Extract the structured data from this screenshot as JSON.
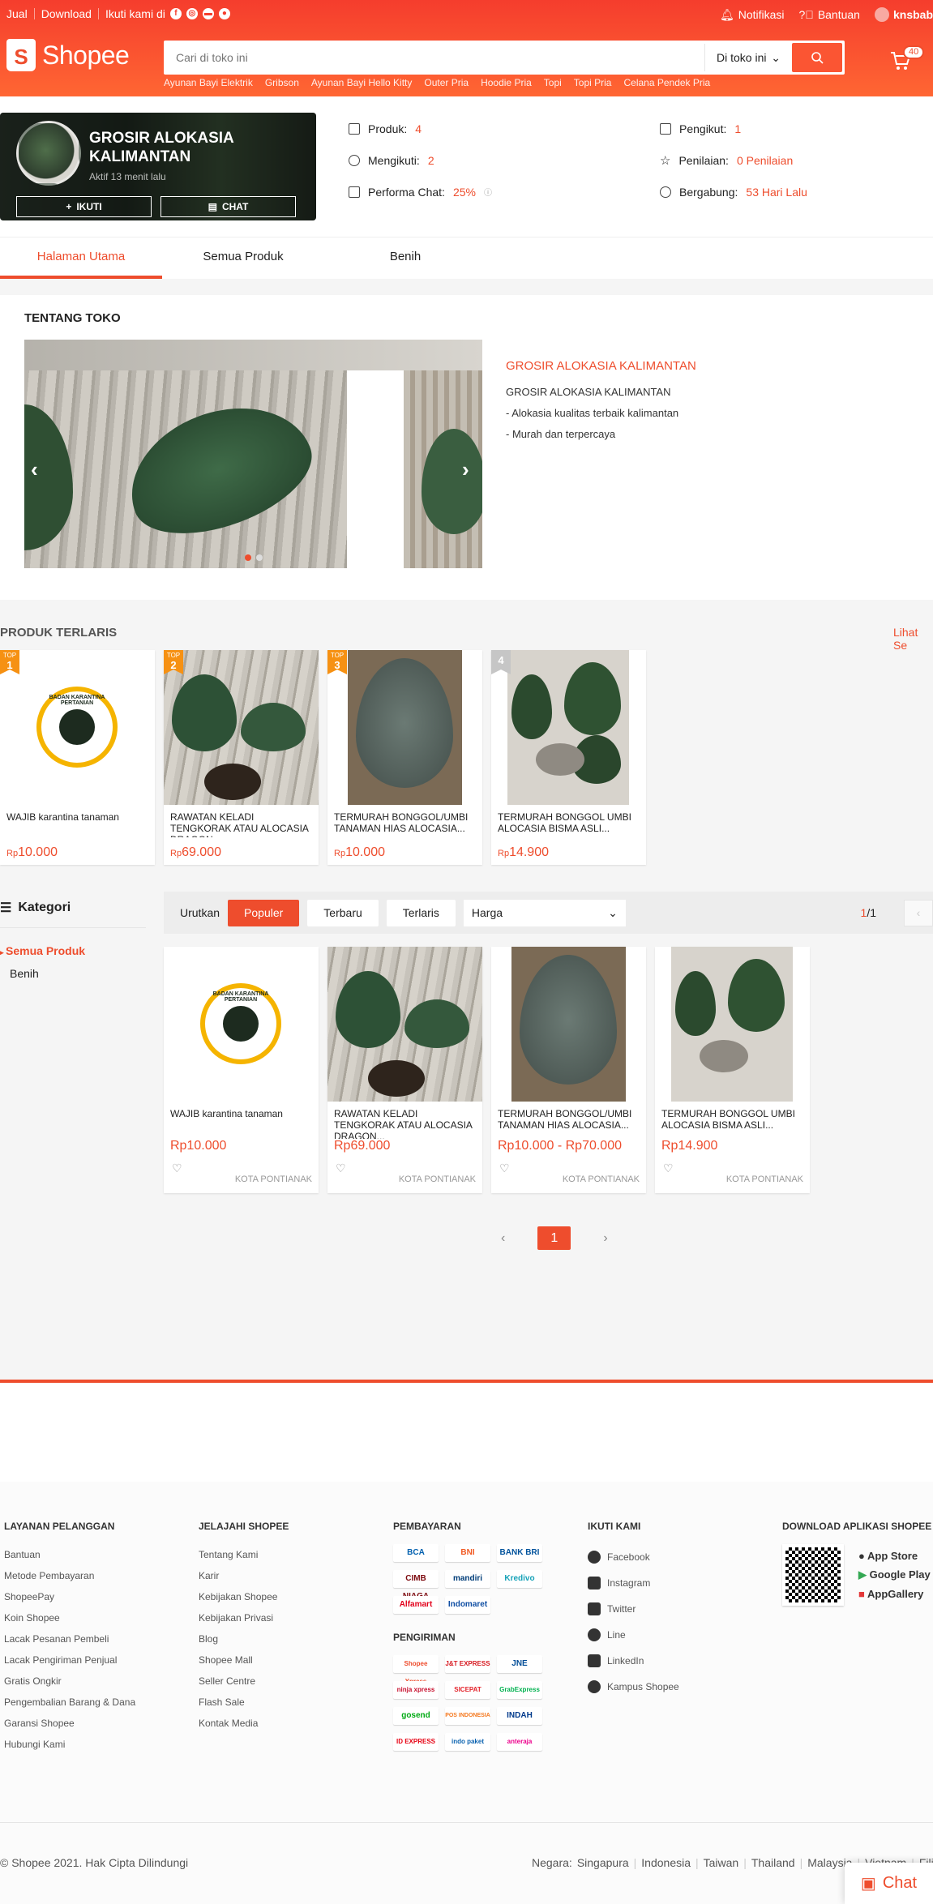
{
  "topbar": {
    "jual": "Jual",
    "download": "Download",
    "follow": "Ikuti kami di",
    "notifikasi": "Notifikasi",
    "bantuan": "Bantuan",
    "user": "knsbab"
  },
  "header": {
    "logo": "Shopee",
    "search_placeholder": "Cari di toko ini",
    "scope": "Di toko ini",
    "cart_count": "40",
    "hints": [
      "Ayunan Bayi Elektrik",
      "Gribson",
      "Ayunan Bayi Hello Kitty",
      "Outer Pria",
      "Hoodie Pria",
      "Topi",
      "Topi Pria",
      "Celana Pendek Pria"
    ]
  },
  "shop": {
    "name": "GROSIR ALOKASIA KALIMANTAN",
    "active": "Aktif 13 menit lalu",
    "follow_btn": "IKUTI",
    "chat_btn": "CHAT",
    "stats": [
      {
        "label": "Produk:",
        "value": "4"
      },
      {
        "label": "Mengikuti:",
        "value": "2"
      },
      {
        "label": "Performa Chat:",
        "value": "25%"
      },
      {
        "label": "Pengikut:",
        "value": "1"
      },
      {
        "label": "Penilaian:",
        "value": "0 Penilaian"
      },
      {
        "label": "Bergabung:",
        "value": "53 Hari Lalu"
      }
    ],
    "tabs": [
      "Halaman Utama",
      "Semua Produk",
      "Benih"
    ]
  },
  "about": {
    "heading": "TENTANG TOKO",
    "title": "GROSIR ALOKASIA KALIMANTAN",
    "lines": [
      "GROSIR ALOKASIA KALIMANTAN",
      "- Alokasia kualitas terbaik kalimantan",
      "- Murah dan terpercaya"
    ]
  },
  "top": {
    "heading": "PRODUK TERLARIS",
    "more": "Lihat Se",
    "items": [
      {
        "rank": "1",
        "name": "WAJIB karantina tanaman",
        "currency": "Rp",
        "price": "10.000"
      },
      {
        "rank": "2",
        "name": "RAWATAN KELADI TENGKORAK ATAU ALOCASIA DRAGON...",
        "currency": "Rp",
        "price": "69.000"
      },
      {
        "rank": "3",
        "name": "TERMURAH BONGGOL/UMBI TANAMAN HIAS ALOCASIA...",
        "currency": "Rp",
        "price": "10.000"
      },
      {
        "rank": "4",
        "name": "TERMURAH BONGGOL UMBI ALOCASIA BISMA ASLI...",
        "currency": "Rp",
        "price": "14.900"
      }
    ]
  },
  "kategori": {
    "heading": "Kategori",
    "items": [
      "Semua Produk",
      "Benih"
    ]
  },
  "sort": {
    "label": "Urutkan",
    "options": [
      "Populer",
      "Terbaru",
      "Terlaris"
    ],
    "price": "Harga",
    "page_cur": "1",
    "page_total": "/1"
  },
  "grid": [
    {
      "name": "WAJIB karantina tanaman",
      "price": "Rp10.000",
      "loc": "KOTA PONTIANAK"
    },
    {
      "name": "RAWATAN KELADI TENGKORAK ATAU ALOCASIA DRAGON...",
      "price": "Rp69.000",
      "loc": "KOTA PONTIANAK"
    },
    {
      "name": "TERMURAH BONGGOL/UMBI TANAMAN HIAS ALOCASIA...",
      "price": "Rp10.000 - Rp70.000",
      "loc": "KOTA PONTIANAK"
    },
    {
      "name": "TERMURAH BONGGOL UMBI ALOCASIA BISMA ASLI...",
      "price": "Rp14.900",
      "loc": "KOTA PONTIANAK"
    }
  ],
  "pager": {
    "current": "1"
  },
  "seal_text": "BADAN KARANTINA PERTANIAN",
  "footer": {
    "layanan": {
      "h": "LAYANAN PELANGGAN",
      "items": [
        "Bantuan",
        "Metode Pembayaran",
        "ShopeePay",
        "Koin Shopee",
        "Lacak Pesanan Pembeli",
        "Lacak Pengiriman Penjual",
        "Gratis Ongkir",
        "Pengembalian Barang & Dana",
        "Garansi Shopee",
        "Hubungi Kami"
      ]
    },
    "jelajahi": {
      "h": "JELAJAHI SHOPEE",
      "items": [
        "Tentang Kami",
        "Karir",
        "Kebijakan Shopee",
        "Kebijakan Privasi",
        "Blog",
        "Shopee Mall",
        "Seller Centre",
        "Flash Sale",
        "Kontak Media"
      ]
    },
    "pembayaran": {
      "h": "PEMBAYARAN",
      "items": [
        "BCA",
        "BNI",
        "BANK BRI",
        "CIMB NIAGA",
        "mandiri",
        "Kredivo",
        "Alfamart",
        "Indomaret"
      ]
    },
    "pengiriman": {
      "h": "PENGIRIMAN",
      "items": [
        "Shopee Xpress",
        "J&T EXPRESS",
        "JNE",
        "ninja xpress",
        "SICEPAT",
        "GrabExpress",
        "gosend",
        "POS INDONESIA",
        "INDAH",
        "ID EXPRESS",
        "indo paket",
        "anteraja"
      ]
    },
    "ikuti": {
      "h": "IKUTI KAMI",
      "items": [
        "Facebook",
        "Instagram",
        "Twitter",
        "Line",
        "LinkedIn",
        "Kampus Shopee"
      ]
    },
    "download": {
      "h": "DOWNLOAD APLIKASI SHOPEE",
      "stores": [
        "App Store",
        "Google Play",
        "AppGallery"
      ]
    },
    "copyright": "© Shopee 2021. Hak Cipta Dilindungi",
    "negara_label": "Negara:",
    "negara": [
      "Singapura",
      "Indonesia",
      "Taiwan",
      "Thailand",
      "Malaysia",
      "Vietnam",
      "Filipina"
    ]
  },
  "chat": "Chat"
}
